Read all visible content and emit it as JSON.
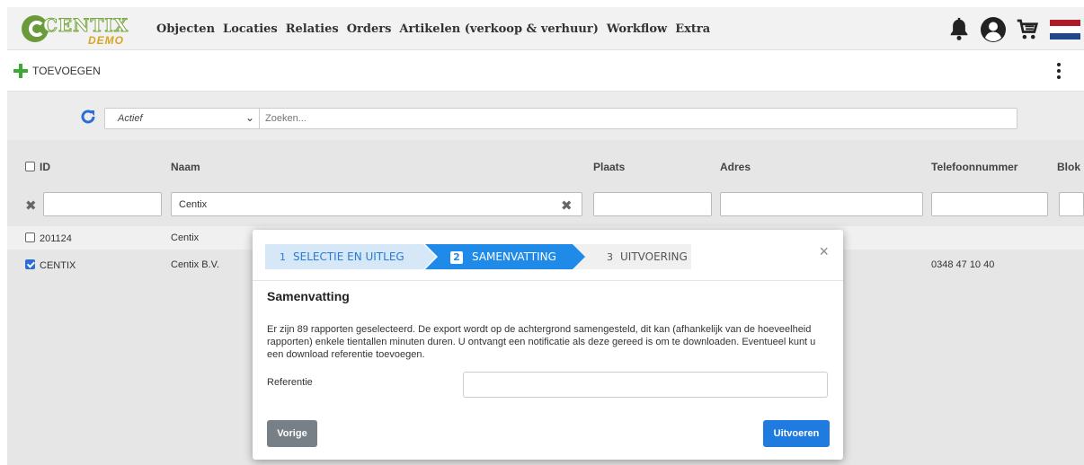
{
  "app": {
    "logo_text": "CENTIX",
    "logo_subtext": "DEMO"
  },
  "nav": {
    "items": [
      {
        "label": "Objecten"
      },
      {
        "label": "Locaties"
      },
      {
        "label": "Relaties"
      },
      {
        "label": "Orders"
      },
      {
        "label": "Artikelen (verkoop & verhuur)"
      },
      {
        "label": "Workflow"
      },
      {
        "label": "Extra"
      }
    ]
  },
  "top_icons": [
    "bell-icon",
    "user-icon",
    "cart-icon",
    "flag-nl-icon"
  ],
  "colors": {
    "accent": "#1f8ae8",
    "add_green": "#3aa935",
    "flag_red": "#ae1c28",
    "flag_white": "#ffffff",
    "flag_blue": "#21468b"
  },
  "toolbar": {
    "add_label": "TOEVOEGEN"
  },
  "filters": {
    "status_value": "Actief",
    "search_placeholder": "Zoeken..."
  },
  "table": {
    "columns": [
      "ID",
      "Naam",
      "Plaats",
      "Adres",
      "Telefoonnummer",
      "Blok"
    ],
    "filter_values": {
      "id": "",
      "naam": "Centix",
      "plaats": "",
      "adres": "",
      "telefoon": "",
      "blok": ""
    },
    "rows": [
      {
        "checked": false,
        "id": "201124",
        "naam": "Centix",
        "plaats": "",
        "adres": "",
        "telefoon": ""
      },
      {
        "checked": true,
        "id": "CENTIX",
        "naam": "Centix B.V.",
        "plaats": "",
        "adres": "",
        "telefoon": "0348 47 10 40"
      }
    ]
  },
  "modal": {
    "steps": [
      {
        "num": "1",
        "label": "SELECTIE EN UITLEG",
        "state": "done"
      },
      {
        "num": "2",
        "label": "SAMENVATTING",
        "state": "active"
      },
      {
        "num": "3",
        "label": "UITVOERING",
        "state": "todo"
      }
    ],
    "close_label": "×",
    "title": "Samenvatting",
    "body": "Er zijn 89 rapporten geselecteerd. De export wordt op de achtergrond samengesteld, dit kan (afhankelijk van de hoeveelheid rapporten) enkele tientallen minuten duren. U ontvangt een notificatie als deze gereed is om te downloaden. Eventueel kunt u een download referentie toevoegen.",
    "reference_label": "Referentie",
    "reference_value": "",
    "prev_label": "Vorige",
    "run_label": "Uitvoeren"
  }
}
